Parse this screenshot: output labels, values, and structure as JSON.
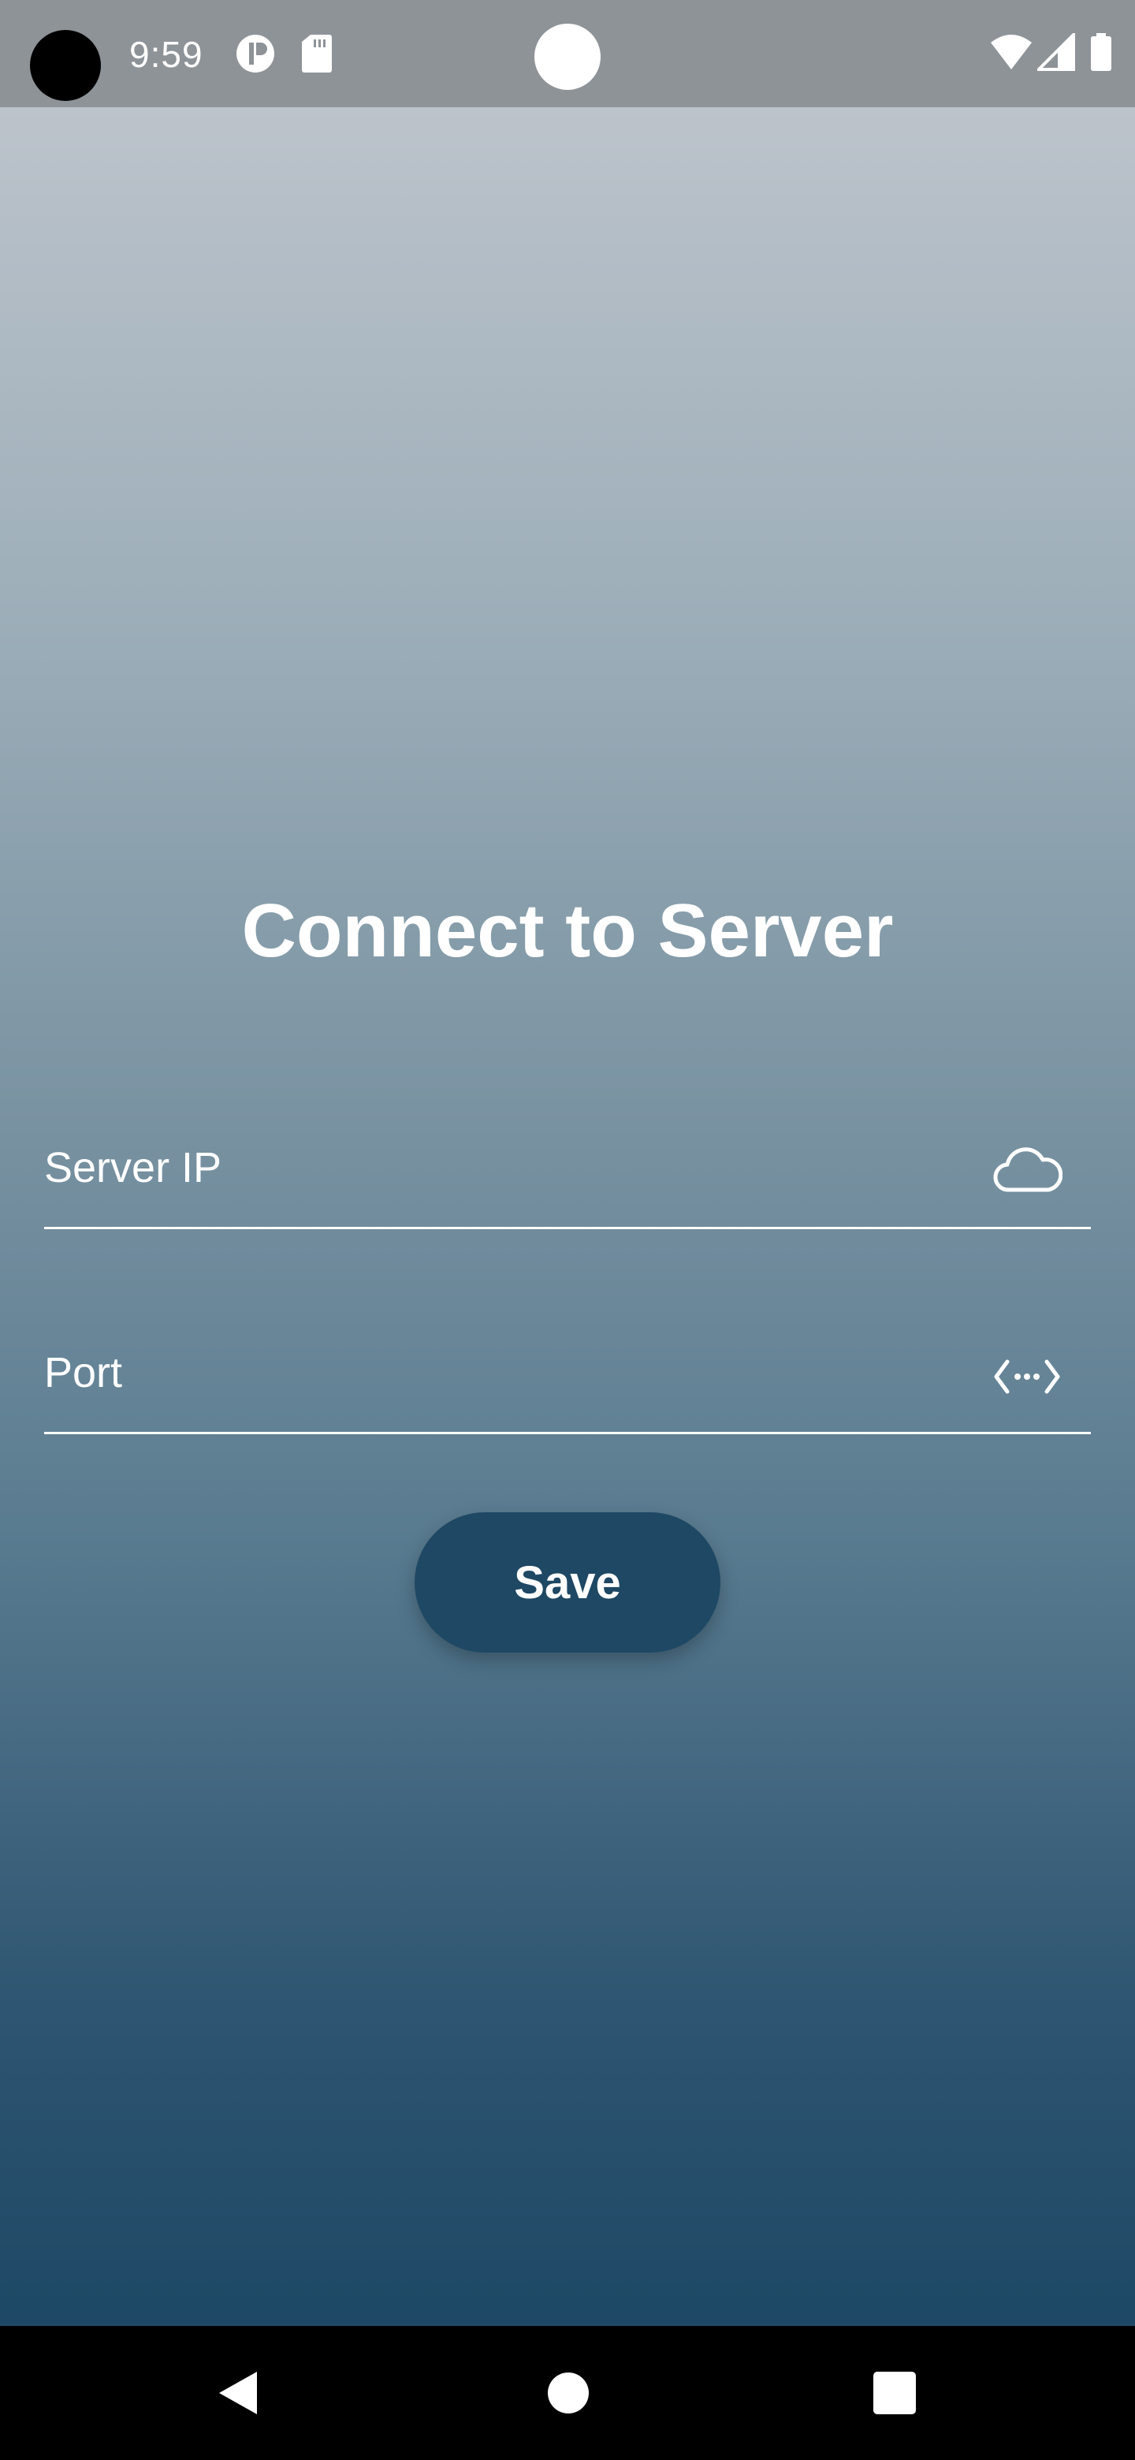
{
  "status_bar": {
    "time": "9:59",
    "icons": [
      "camera-hole",
      "notification-app-icon",
      "sd-card-icon",
      "wifi-icon",
      "cellular-signal-icon",
      "battery-icon"
    ]
  },
  "screen": {
    "title": "Connect to Server"
  },
  "form": {
    "server_ip": {
      "placeholder": "Server IP",
      "value": "",
      "icon": "cloud-icon"
    },
    "port": {
      "placeholder": "Port",
      "value": "",
      "icon": "settings-ethernet-icon"
    },
    "save_label": "Save"
  },
  "nav_bar": {
    "buttons": [
      "back-icon",
      "home-icon",
      "recents-icon"
    ]
  },
  "colors": {
    "gradient_top": "#bcc3cb",
    "gradient_bottom": "#1d4865",
    "button": "#1e4864",
    "status_bar": "#8e9398",
    "text": "#ffffff"
  }
}
